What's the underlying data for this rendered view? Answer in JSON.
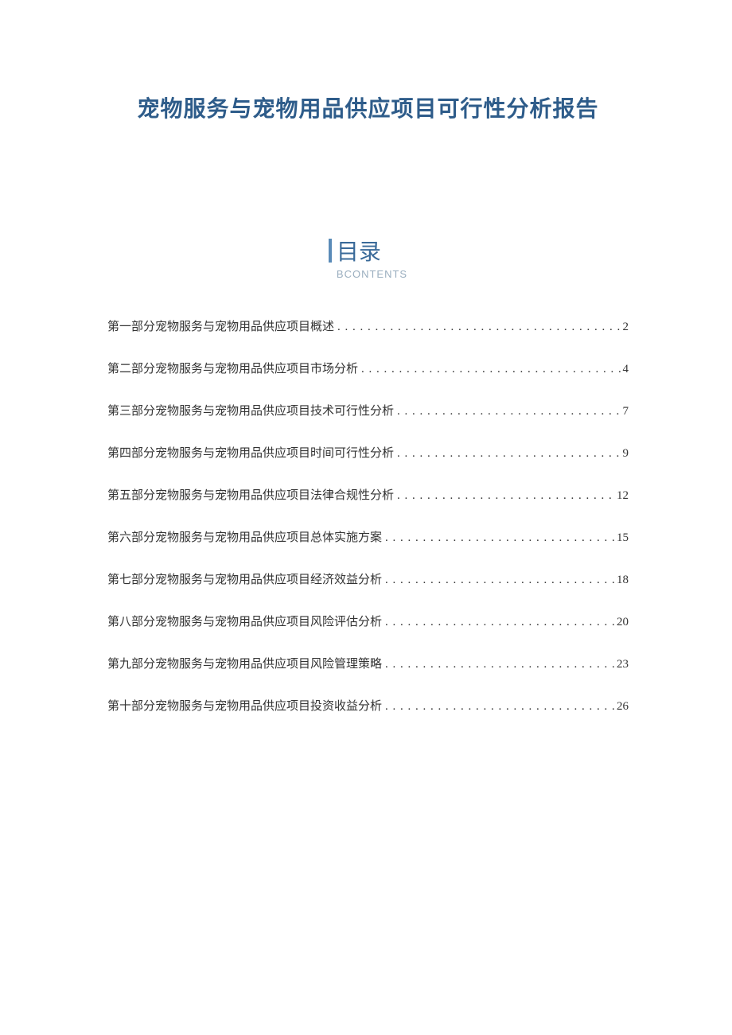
{
  "title": "宠物服务与宠物用品供应项目可行性分析报告",
  "toc": {
    "heading": "目录",
    "subheading": "BCONTENTS",
    "items": [
      {
        "label": "第一部分宠物服务与宠物用品供应项目概述",
        "page": "2"
      },
      {
        "label": "第二部分宠物服务与宠物用品供应项目市场分析",
        "page": "4"
      },
      {
        "label": "第三部分宠物服务与宠物用品供应项目技术可行性分析",
        "page": "7"
      },
      {
        "label": "第四部分宠物服务与宠物用品供应项目时间可行性分析",
        "page": "9"
      },
      {
        "label": "第五部分宠物服务与宠物用品供应项目法律合规性分析",
        "page": "12"
      },
      {
        "label": "第六部分宠物服务与宠物用品供应项目总体实施方案",
        "page": "15"
      },
      {
        "label": "第七部分宠物服务与宠物用品供应项目经济效益分析",
        "page": "18"
      },
      {
        "label": "第八部分宠物服务与宠物用品供应项目风险评估分析",
        "page": "20"
      },
      {
        "label": "第九部分宠物服务与宠物用品供应项目风险管理策略",
        "page": "23"
      },
      {
        "label": "第十部分宠物服务与宠物用品供应项目投资收益分析",
        "page": "26"
      }
    ]
  }
}
